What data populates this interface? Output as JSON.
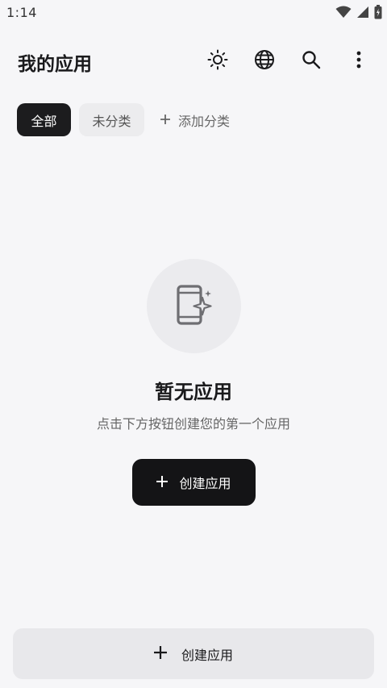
{
  "status_bar": {
    "time": "1:14",
    "icons": [
      "wifi-icon",
      "cell-signal-icon",
      "battery-icon"
    ]
  },
  "app_bar": {
    "title": "我的应用",
    "actions": [
      "theme-sun-icon",
      "language-globe-icon",
      "search-icon",
      "more-vert-icon"
    ]
  },
  "categories": {
    "all": "全部",
    "uncategorized": "未分类",
    "add": "添加分类",
    "selected": "全部"
  },
  "empty_state": {
    "icon": "app-sparkle-icon",
    "title": "暂无应用",
    "subtitle": "点击下方按钮创建您的第一个应用",
    "button_label": "创建应用"
  },
  "bottom_button": {
    "label": "创建应用"
  },
  "colors": {
    "background": "#f6f6f8",
    "primary_button": "#141416",
    "chip_active": "#1c1c1e",
    "chip_inactive": "#ececee",
    "bottom_button": "#e8e8eb"
  }
}
